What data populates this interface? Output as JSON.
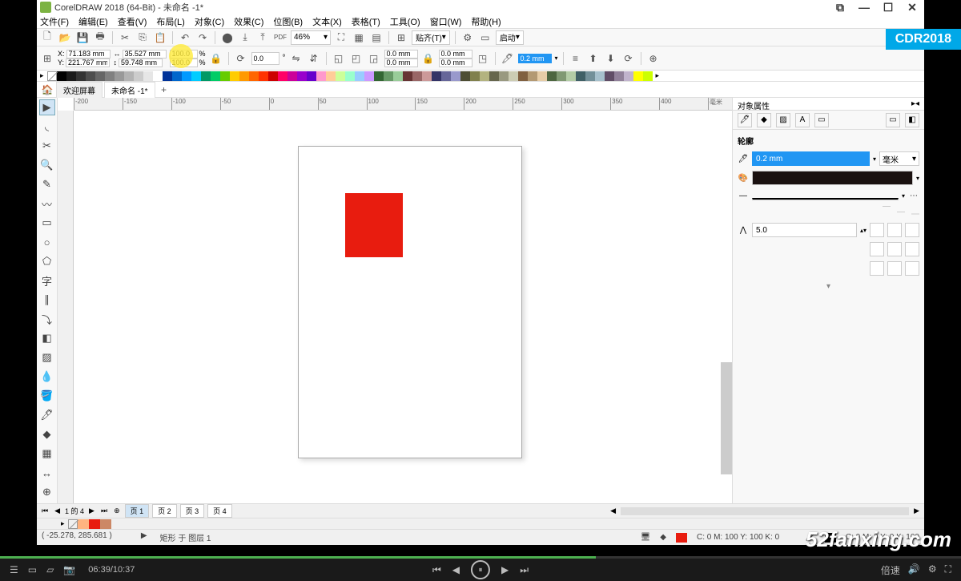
{
  "title": "CorelDRAW 2018 (64-Bit) - 未命名 -1*",
  "menus": [
    "文件(F)",
    "编辑(E)",
    "查看(V)",
    "布局(L)",
    "对象(C)",
    "效果(C)",
    "位图(B)",
    "文本(X)",
    "表格(T)",
    "工具(O)",
    "窗口(W)",
    "帮助(H)"
  ],
  "zoom": "46%",
  "snap_label": "贴齐(T)",
  "launch_label": "启动",
  "coord": {
    "x": "71.183 mm",
    "y": "221.767 mm",
    "w": "35.527 mm",
    "h": "59.748 mm",
    "sx": "100.0",
    "sy": "100.0",
    "pct": "%",
    "rot": "0.0",
    "deg": "°"
  },
  "outline_mm": "0.0 mm",
  "outline_hl": "0.2 mm",
  "tabs": {
    "welcome": "欢迎屏幕",
    "doc": "未命名 -1*"
  },
  "ruler_ticks": [
    "-200",
    "-150",
    "-100",
    "-50",
    "0",
    "50",
    "100",
    "150",
    "200",
    "250",
    "300",
    "350",
    "400"
  ],
  "ruler_unit": "毫米",
  "docker": {
    "header": "对象属性",
    "section": "轮廓",
    "width_val": "0.2 mm",
    "unit": "毫米",
    "miter": "5.0"
  },
  "pages": {
    "counter": "1 的 4",
    "tabs": [
      "页 1",
      "页 2",
      "页 3",
      "页 4"
    ]
  },
  "status": {
    "cursor": "( -25.278, 285.681 )",
    "object": "矩形 于 图层 1",
    "fill": "C: 0 M: 100 Y: 100 K: 0",
    "outline": "C: 0 M: 0 Y: 0 K: 100"
  },
  "video": {
    "time": "06:39/10:37"
  },
  "watermarks": {
    "cdr": "CDR2018",
    "site": "52fanxing.com"
  },
  "palette": [
    "#000000",
    "#1a1a1a",
    "#333333",
    "#4d4d4d",
    "#666666",
    "#808080",
    "#999999",
    "#b3b3b3",
    "#cccccc",
    "#e6e6e6",
    "#ffffff",
    "#003399",
    "#0066cc",
    "#0099ff",
    "#00ccff",
    "#009966",
    "#00cc66",
    "#66cc00",
    "#ffcc00",
    "#ff9900",
    "#ff6600",
    "#ff3300",
    "#cc0000",
    "#ff0066",
    "#cc0099",
    "#9900cc",
    "#6600cc",
    "#ff99cc",
    "#ffcc99",
    "#ccff99",
    "#99ffcc",
    "#99ccff",
    "#cc99ff",
    "#336633",
    "#669966",
    "#99cc99",
    "#663333",
    "#996666",
    "#cc9999",
    "#333366",
    "#666699",
    "#9999cc",
    "#4d4d33",
    "#80804d",
    "#b3b380",
    "#66664d",
    "#999980",
    "#ccccb3",
    "#806040",
    "#b39973",
    "#e6cca6",
    "#4d6640",
    "#809973",
    "#b3cca6",
    "#406066",
    "#739099",
    "#a6c0cc",
    "#604d66",
    "#908099",
    "#c0b3cc",
    "#ffff00",
    "#ccff00"
  ]
}
